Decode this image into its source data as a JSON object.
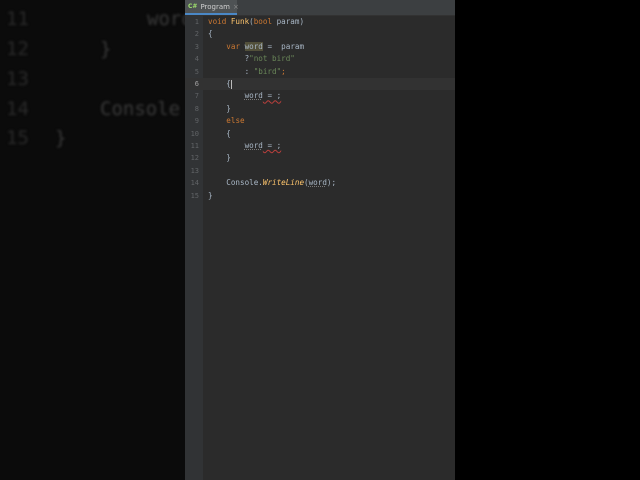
{
  "background": {
    "line_numbers": [
      "11",
      "12",
      "13",
      "14",
      "15"
    ],
    "code_fragments": [
      "word",
      "}",
      "Console",
      "}"
    ]
  },
  "tab": {
    "icon": "C#",
    "label": "Program",
    "close": "×"
  },
  "editor": {
    "lines": [
      {
        "num": "1",
        "tokens": [
          {
            "t": "kw",
            "v": "void "
          },
          {
            "t": "fnd",
            "v": "Funk"
          },
          {
            "t": "p",
            "v": "("
          },
          {
            "t": "kw",
            "v": "bool "
          },
          {
            "t": "p",
            "v": "param)"
          }
        ]
      },
      {
        "num": "2",
        "tokens": [
          {
            "t": "p",
            "v": "{"
          }
        ]
      },
      {
        "num": "3",
        "tokens": [
          {
            "t": "p",
            "v": "    "
          },
          {
            "t": "kw",
            "v": "var "
          },
          {
            "t": "hl",
            "v": "word"
          },
          {
            "t": "p",
            "v": " =  param"
          }
        ]
      },
      {
        "num": "4",
        "tokens": [
          {
            "t": "p",
            "v": "        ?"
          },
          {
            "t": "str",
            "v": "\"not bird\""
          }
        ]
      },
      {
        "num": "5",
        "tokens": [
          {
            "t": "p",
            "v": "        : "
          },
          {
            "t": "str",
            "v": "\"bird\""
          },
          {
            "t": "kw",
            "v": ";"
          }
        ]
      },
      {
        "num": "6",
        "current": true,
        "tokens": [
          {
            "t": "p",
            "v": "    {"
          },
          {
            "t": "caret",
            "v": ""
          }
        ]
      },
      {
        "num": "7",
        "tokens": [
          {
            "t": "p",
            "v": "        "
          },
          {
            "t": "var",
            "v": "word"
          },
          {
            "t": "err",
            "v": " = ;"
          }
        ]
      },
      {
        "num": "8",
        "tokens": [
          {
            "t": "p",
            "v": "    }"
          }
        ]
      },
      {
        "num": "9",
        "tokens": [
          {
            "t": "p",
            "v": "    "
          },
          {
            "t": "kw",
            "v": "else"
          }
        ]
      },
      {
        "num": "10",
        "tokens": [
          {
            "t": "p",
            "v": "    {"
          }
        ]
      },
      {
        "num": "11",
        "tokens": [
          {
            "t": "p",
            "v": "        "
          },
          {
            "t": "var",
            "v": "word"
          },
          {
            "t": "err",
            "v": " = ;"
          }
        ]
      },
      {
        "num": "12",
        "tokens": [
          {
            "t": "p",
            "v": "    }"
          }
        ]
      },
      {
        "num": "13",
        "tokens": []
      },
      {
        "num": "14",
        "tokens": [
          {
            "t": "p",
            "v": "    Console."
          },
          {
            "t": "fn",
            "v": "WriteLine"
          },
          {
            "t": "p",
            "v": "("
          },
          {
            "t": "var",
            "v": "word"
          },
          {
            "t": "p",
            "v": ");"
          }
        ]
      },
      {
        "num": "15",
        "tokens": [
          {
            "t": "p",
            "v": "}"
          }
        ]
      }
    ]
  },
  "colors": {
    "editor_bg": "#2b2b2b",
    "keyword": "#cc7832",
    "string": "#6a8759",
    "method": "#ffc66d",
    "text": "#a9b7c6"
  }
}
